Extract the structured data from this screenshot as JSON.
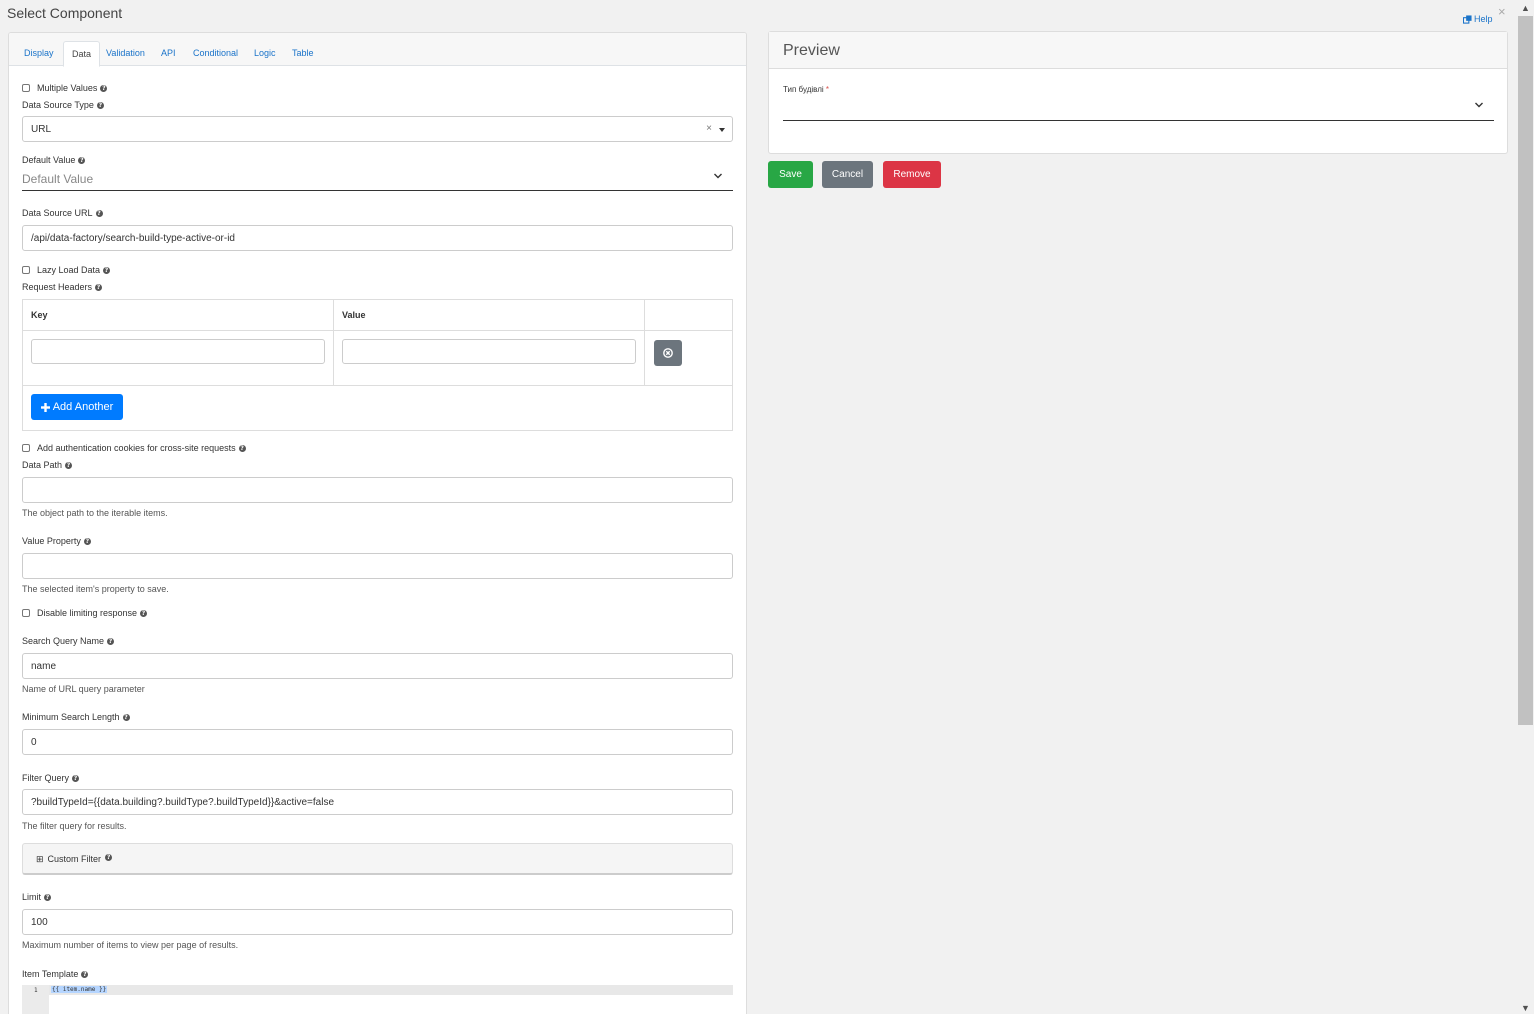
{
  "window": {
    "title": "Select Component",
    "help_label": "Help",
    "close_glyph": "×"
  },
  "tabs": [
    {
      "label": "Display"
    },
    {
      "label": "Data"
    },
    {
      "label": "Validation"
    },
    {
      "label": "API"
    },
    {
      "label": "Conditional"
    },
    {
      "label": "Logic"
    },
    {
      "label": "Table"
    }
  ],
  "active_tab": "Data",
  "form": {
    "multiple_values": {
      "label": "Multiple Values",
      "checked": false
    },
    "data_source_type": {
      "label": "Data Source Type",
      "value": "URL",
      "clear_glyph": "×"
    },
    "default_value": {
      "label": "Default Value",
      "placeholder": "Default Value"
    },
    "data_source_url": {
      "label": "Data Source URL",
      "value": "/api/data-factory/search-build-type-active-or-id"
    },
    "lazy_load": {
      "label": "Lazy Load Data",
      "checked": false
    },
    "request_headers": {
      "label": "Request Headers",
      "columns": [
        "Key",
        "Value"
      ],
      "add_button": "Add Another",
      "rows": [
        {
          "key": "",
          "value": ""
        }
      ]
    },
    "auth_cookies": {
      "label": "Add authentication cookies for cross-site requests",
      "checked": false
    },
    "data_path": {
      "label": "Data Path",
      "value": "",
      "description": "The object path to the iterable items."
    },
    "value_property": {
      "label": "Value Property",
      "value": "",
      "description": "The selected item's property to save."
    },
    "disable_limiting": {
      "label": "Disable limiting response",
      "checked": false
    },
    "search_query_name": {
      "label": "Search Query Name",
      "value": "name",
      "description": "Name of URL query parameter"
    },
    "min_search_length": {
      "label": "Minimum Search Length",
      "value": "0"
    },
    "filter_query": {
      "label": "Filter Query",
      "value": "?buildTypeId={{data.building?.buildType?.buildTypeId}}&active=false",
      "description": "The filter query for results."
    },
    "custom_filter": {
      "label": "Custom Filter",
      "expand_glyph": "⊞"
    },
    "limit": {
      "label": "Limit",
      "value": "100",
      "description": "Maximum number of items to view per page of results."
    },
    "item_template": {
      "label": "Item Template",
      "line_number": "1",
      "code": "{{ item.name }}"
    }
  },
  "preview": {
    "title": "Preview",
    "field_label": "Тип будівлі",
    "required_marker": "*"
  },
  "actions": {
    "save": "Save",
    "cancel": "Cancel",
    "remove": "Remove"
  },
  "colors": {
    "link_blue": "#1a73c9",
    "primary": "#007bff",
    "success": "#28a745",
    "secondary": "#6c757d",
    "danger": "#dc3545"
  }
}
